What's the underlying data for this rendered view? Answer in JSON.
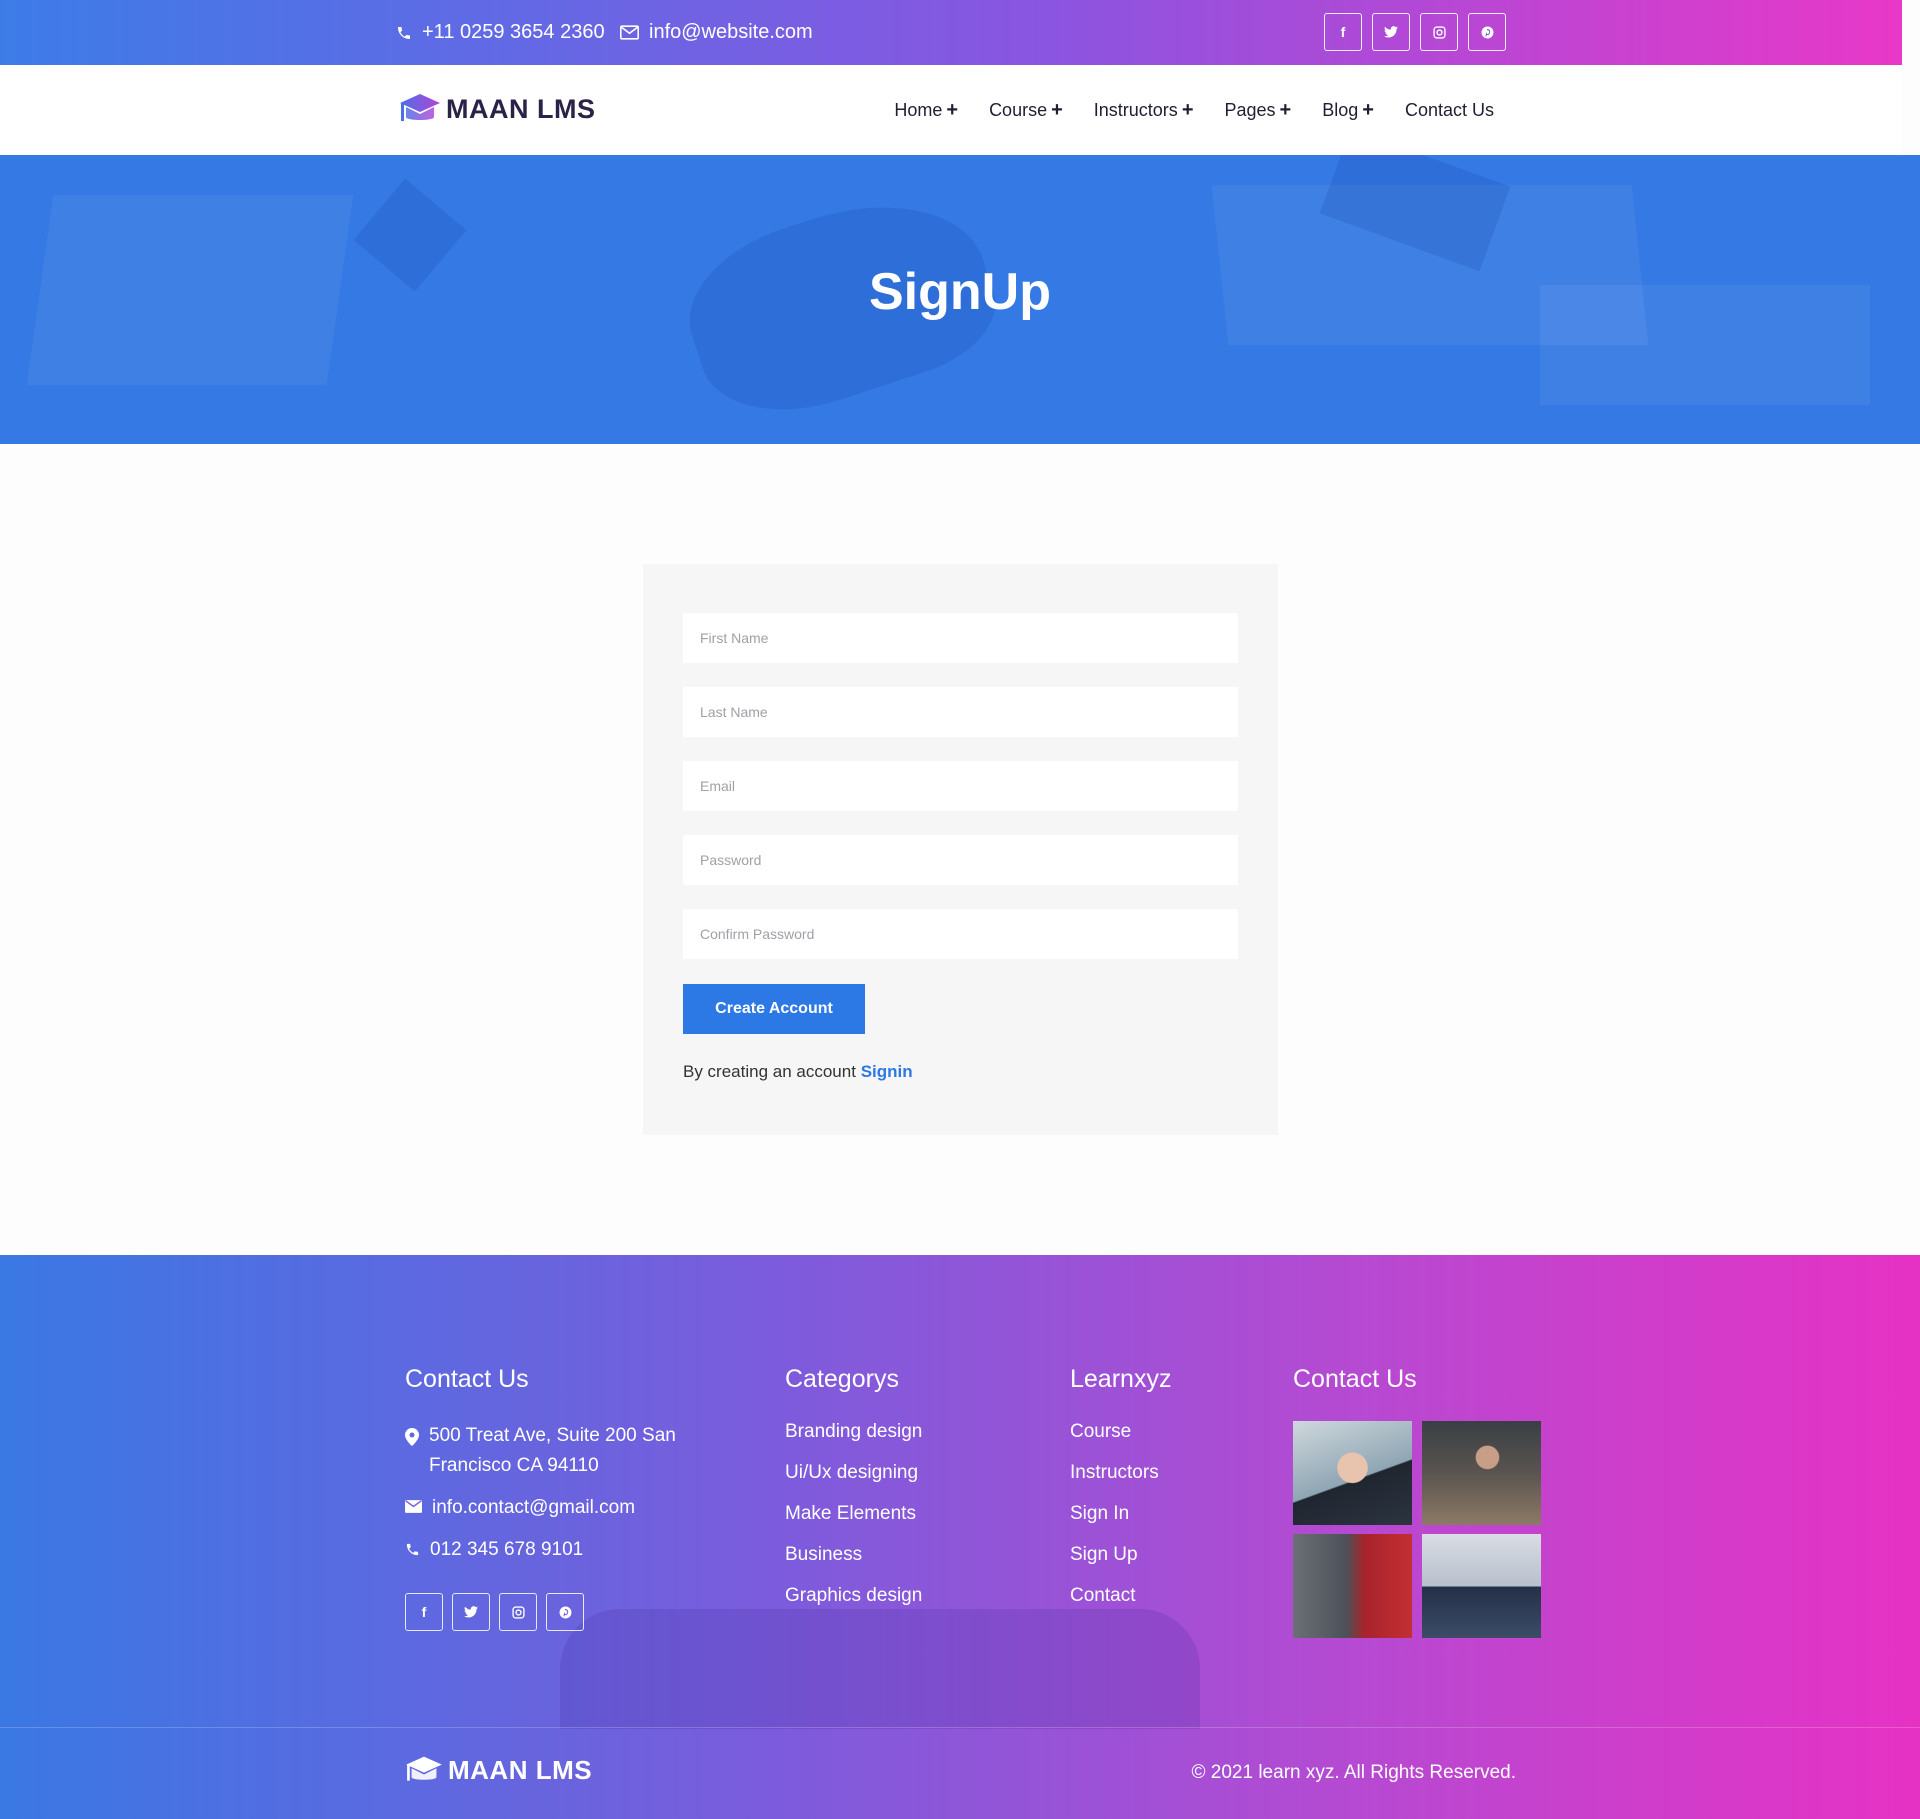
{
  "topbar": {
    "phone": "+11 0259 3654 2360",
    "email": "info@website.com",
    "socials": [
      "facebook-icon",
      "twitter-icon",
      "instagram-icon",
      "pinterest-icon"
    ]
  },
  "brand": {
    "name": "MAAN LMS"
  },
  "nav": {
    "items": [
      {
        "label": "Home",
        "has_submenu": true
      },
      {
        "label": "Course",
        "has_submenu": true
      },
      {
        "label": "Instructors",
        "has_submenu": true
      },
      {
        "label": "Pages",
        "has_submenu": true
      },
      {
        "label": "Blog",
        "has_submenu": true
      },
      {
        "label": "Contact Us",
        "has_submenu": false
      }
    ]
  },
  "hero": {
    "title": "SignUp"
  },
  "form": {
    "first_name_placeholder": "First Name",
    "last_name_placeholder": "Last Name",
    "email_placeholder": "Email",
    "password_placeholder": "Password",
    "confirm_password_placeholder": "Confirm Password",
    "submit_label": "Create Account",
    "footer_text": "By creating an account",
    "signin_label": "Signin"
  },
  "footer": {
    "contact": {
      "heading": "Contact Us",
      "address": "500 Treat Ave, Suite 200 San Francisco CA 94110",
      "email": "info.contact@gmail.com",
      "phone": "012 345 678 9101"
    },
    "categories": {
      "heading": "Categorys",
      "items": [
        "Branding design",
        "Ui/Ux designing",
        "Make Elements",
        "Business",
        "Graphics design"
      ]
    },
    "learn": {
      "heading": "Learnxyz",
      "items": [
        "Course",
        "Instructors",
        "Sign In",
        "Sign Up",
        "Contact"
      ]
    },
    "gallery": {
      "heading": "Contact Us"
    },
    "copyright": "© 2021 learn xyz. All Rights Reserved."
  },
  "colors": {
    "accent": "#2c78e4",
    "gradient_start": "#3d7ce8",
    "gradient_end": "#e838c8",
    "hero_bg": "#3479e4"
  }
}
